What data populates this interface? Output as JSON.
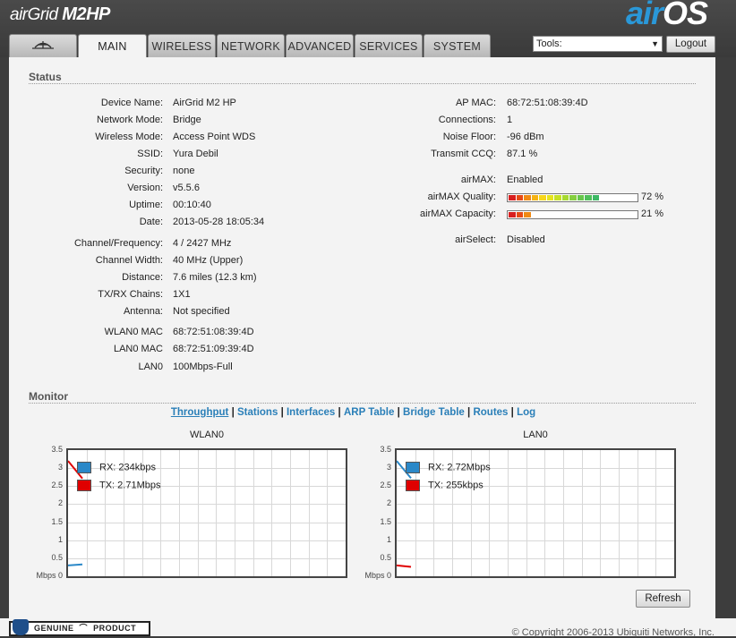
{
  "header": {
    "brand_prefix": "airGrid",
    "brand_model": "M2HP",
    "os_air": "air",
    "os_name": "OS"
  },
  "tabs": [
    {
      "label": "",
      "icon": "ubiquiti-logo-icon"
    },
    {
      "label": "MAIN"
    },
    {
      "label": "WIRELESS"
    },
    {
      "label": "NETWORK"
    },
    {
      "label": "ADVANCED"
    },
    {
      "label": "SERVICES"
    },
    {
      "label": "SYSTEM"
    }
  ],
  "tools": {
    "label": "Tools:"
  },
  "logout_label": "Logout",
  "status": {
    "title": "Status",
    "left": [
      {
        "label": "Device Name:",
        "value": "AirGrid M2 HP"
      },
      {
        "label": "Network Mode:",
        "value": "Bridge"
      },
      {
        "label": "Wireless Mode:",
        "value": "Access Point WDS"
      },
      {
        "label": "SSID:",
        "value": "Yura Debil"
      },
      {
        "label": "Security:",
        "value": "none"
      },
      {
        "label": "Version:",
        "value": "v5.5.6"
      },
      {
        "label": "Uptime:",
        "value": "00:10:40"
      },
      {
        "label": "Date:",
        "value": "2013-05-28 18:05:34"
      },
      {
        "label": "Channel/Frequency:",
        "value": "4 / 2427 MHz"
      },
      {
        "label": "Channel Width:",
        "value": "40 MHz (Upper)"
      },
      {
        "label": "Distance:",
        "value": "7.6 miles (12.3 km)"
      },
      {
        "label": "TX/RX Chains:",
        "value": "1X1"
      },
      {
        "label": "Antenna:",
        "value": "Not specified"
      },
      {
        "label": "WLAN0 MAC",
        "value": "68:72:51:08:39:4D"
      },
      {
        "label": "LAN0 MAC",
        "value": "68:72:51:09:39:4D"
      },
      {
        "label": "LAN0",
        "value": "100Mbps-Full"
      }
    ],
    "right": [
      {
        "label": "AP MAC:",
        "value": "68:72:51:08:39:4D"
      },
      {
        "label": "Connections:",
        "value": "1"
      },
      {
        "label": "Noise Floor:",
        "value": "-96 dBm"
      },
      {
        "label": "Transmit CCQ:",
        "value": "87.1 %"
      },
      {
        "label": "airMAX:",
        "value": "Enabled"
      },
      {
        "label": "airMAX Quality:",
        "value": "72 %",
        "level": 72
      },
      {
        "label": "airMAX Capacity:",
        "value": "21 %",
        "level": 21
      },
      {
        "label": "airSelect:",
        "value": "Disabled"
      }
    ]
  },
  "monitor": {
    "title": "Monitor",
    "links": [
      "Throughput",
      "Stations",
      "Interfaces",
      "ARP Table",
      "Bridge Table",
      "Routes",
      "Log"
    ],
    "separator": "|"
  },
  "graphs": [
    {
      "title": "WLAN0",
      "y_ticks": [
        "3.5",
        "3",
        "2.5",
        "2",
        "1.5",
        "1",
        "0.5",
        "Mbps 0"
      ],
      "rx_label": "RX: 234kbps",
      "tx_label": "TX: 2.71Mbps",
      "rx_values": [
        0.3,
        0.33
      ],
      "tx_values": [
        3.2,
        2.71
      ]
    },
    {
      "title": "LAN0",
      "y_ticks": [
        "3.5",
        "3",
        "2.5",
        "2",
        "1.5",
        "1",
        "0.5",
        "Mbps 0"
      ],
      "rx_label": "RX: 2.72Mbps",
      "tx_label": "TX: 255kbps",
      "rx_values": [
        3.2,
        2.72
      ],
      "tx_values": [
        0.3,
        0.26
      ]
    }
  ],
  "colors": {
    "rx": "#2a88c8",
    "tx": "#e00000",
    "link": "#2a7fb8"
  },
  "refresh_label": "Refresh",
  "footer": {
    "badge_left": "GENUINE",
    "badge_right": "PRODUCT",
    "copyright": "© Copyright 2006-2013 Ubiquiti Networks, Inc."
  }
}
